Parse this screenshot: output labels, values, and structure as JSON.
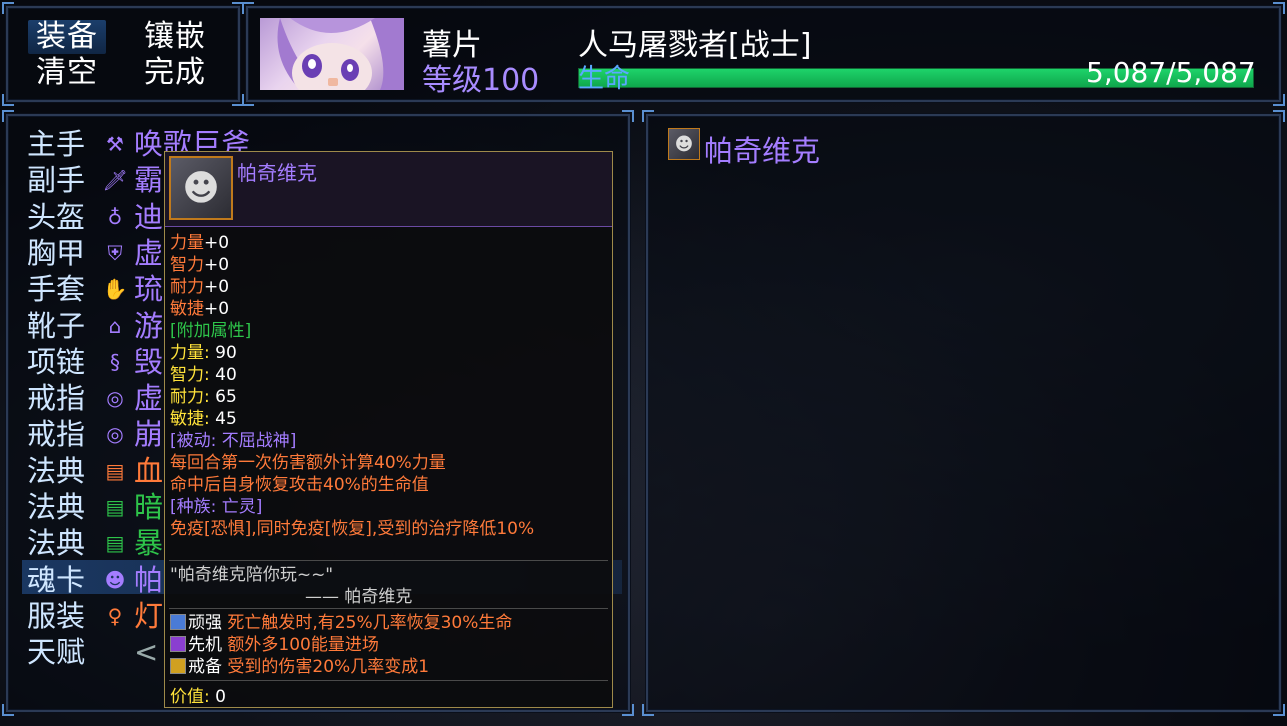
{
  "colors": {
    "accent_blue": "#2b3a55",
    "hp_green": "#1ed36a",
    "item_violet": "#a47dff",
    "item_orange": "#ff7a3a",
    "item_green": "#2ec44a"
  },
  "top_left": {
    "equip_label": "装备",
    "inlay_label": "镶嵌",
    "clear_label": "清空",
    "done_label": "完成"
  },
  "character": {
    "name": "薯片",
    "level_label": "等级",
    "level_value": "100",
    "title": "人马屠戮者[战士]",
    "hp_label": "生命",
    "hp_text": "5,087/5,087",
    "hp_fraction": 1.0
  },
  "slots": [
    {
      "label": "主手",
      "item": "唤歌巨斧",
      "color": "#a47dff",
      "icon": "axe-icon"
    },
    {
      "label": "副手",
      "item": "霸",
      "color": "#a47dff",
      "icon": "dagger-icon"
    },
    {
      "label": "头盔",
      "item": "迪",
      "color": "#a47dff",
      "icon": "helmet-icon"
    },
    {
      "label": "胸甲",
      "item": "虚",
      "color": "#a47dff",
      "icon": "chest-icon"
    },
    {
      "label": "手套",
      "item": "琉",
      "color": "#a47dff",
      "icon": "glove-icon"
    },
    {
      "label": "靴子",
      "item": "游",
      "color": "#a47dff",
      "icon": "boots-icon"
    },
    {
      "label": "项链",
      "item": "毁",
      "color": "#a47dff",
      "icon": "necklace-icon"
    },
    {
      "label": "戒指",
      "item": "虚",
      "color": "#a47dff",
      "icon": "ring-icon"
    },
    {
      "label": "戒指",
      "item": "崩",
      "color": "#a47dff",
      "icon": "ring-icon"
    },
    {
      "label": "法典",
      "item": "血",
      "color": "#ff7a3a",
      "icon": "book-icon"
    },
    {
      "label": "法典",
      "item": "暗",
      "color": "#2ec44a",
      "icon": "book-icon"
    },
    {
      "label": "法典",
      "item": "暴",
      "color": "#2ec44a",
      "icon": "book-icon"
    },
    {
      "label": "魂卡",
      "item": "帕",
      "color": "#a47dff",
      "icon": "soul-card-icon"
    },
    {
      "label": "服装",
      "item": "灯",
      "color": "#ff7a3a",
      "icon": "costume-icon"
    },
    {
      "label": "天赋",
      "item": "<",
      "color": "#9aa",
      "icon": ""
    }
  ],
  "right_panel": {
    "item_name": "帕奇维克"
  },
  "tooltip": {
    "name": "帕奇维克",
    "base_stats": [
      {
        "name": "力量",
        "value": "+0"
      },
      {
        "name": "智力",
        "value": "+0"
      },
      {
        "name": "耐力",
        "value": "+0"
      },
      {
        "name": "敏捷",
        "value": "+0"
      }
    ],
    "extra_header": "[附加属性]",
    "extra_stats": [
      {
        "name": "力量:",
        "value": "90"
      },
      {
        "name": "智力:",
        "value": "40"
      },
      {
        "name": "耐力:",
        "value": "65"
      },
      {
        "name": "敏捷:",
        "value": "45"
      }
    ],
    "passive_header": "[被动: 不屈战神]",
    "passive_lines": [
      "每回合第一次伤害额外计算40%力量",
      "命中后自身恢复攻击40%的生命值"
    ],
    "race_header": "[种族: 亡灵]",
    "race_line": "免疫[恐惧],同时免疫[恢复],受到的治疗降低10%",
    "quote": "\"帕奇维克陪你玩~~\"",
    "quote_author": "—— 帕奇维克",
    "skills": [
      {
        "name": "顽强",
        "desc": "死亡触发时,有25%几率恢复30%生命",
        "icon": "shield-skill-icon"
      },
      {
        "name": "先机",
        "desc": "额外多100能量进场",
        "icon": "feather-skill-icon"
      },
      {
        "name": "戒备",
        "desc": "受到的伤害20%几率变成1",
        "icon": "guard-skill-icon"
      }
    ],
    "value_label": "价值:",
    "value": "0"
  }
}
